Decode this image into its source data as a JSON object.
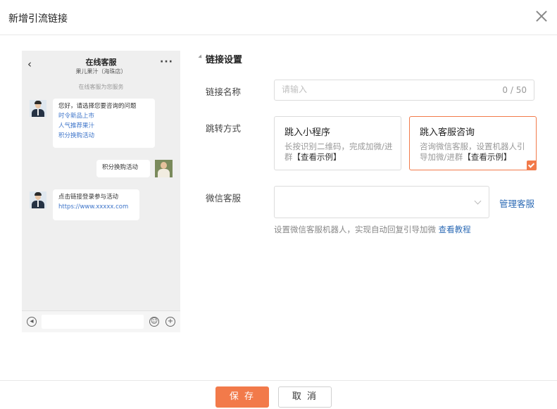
{
  "dialog": {
    "title": "新增引流链接"
  },
  "preview": {
    "title": "在线客服",
    "subtitle": "果儿果汁（海珠店）",
    "notice": "在线客服为您服务",
    "greeting": "您好，请选择您要咨询的问题",
    "greeting_links": [
      "时令新品上市",
      "人气推荐果汁",
      "积分换购活动"
    ],
    "user_message": "积分换购活动",
    "reply_text": "点击链接登录参与活动",
    "reply_link": "https://www.xxxxx.com"
  },
  "form": {
    "section_title": "链接设置",
    "name_label": "链接名称",
    "name_placeholder": "请输入",
    "name_value": "",
    "name_counter": "0 / 50",
    "jump_label": "跳转方式",
    "options": [
      {
        "title": "跳入小程序",
        "desc": "长按识别二维码，完成加微/进群",
        "example": "【查看示例】",
        "selected": false
      },
      {
        "title": "跳入客服咨询",
        "desc": "咨询微信客服，设置机器人引导加微/进群",
        "example": "【查看示例】",
        "selected": true
      }
    ],
    "wechat_label": "微信客服",
    "wechat_value": "",
    "manage_link": "管理客服",
    "hint": "设置微信客服机器人，实现自动回复引导加微",
    "hint_link": "查看教程"
  },
  "footer": {
    "save_label": "保 存",
    "cancel_label": "取 消"
  },
  "colors": {
    "accent": "#f27a4a",
    "link": "#2d6bb5"
  }
}
